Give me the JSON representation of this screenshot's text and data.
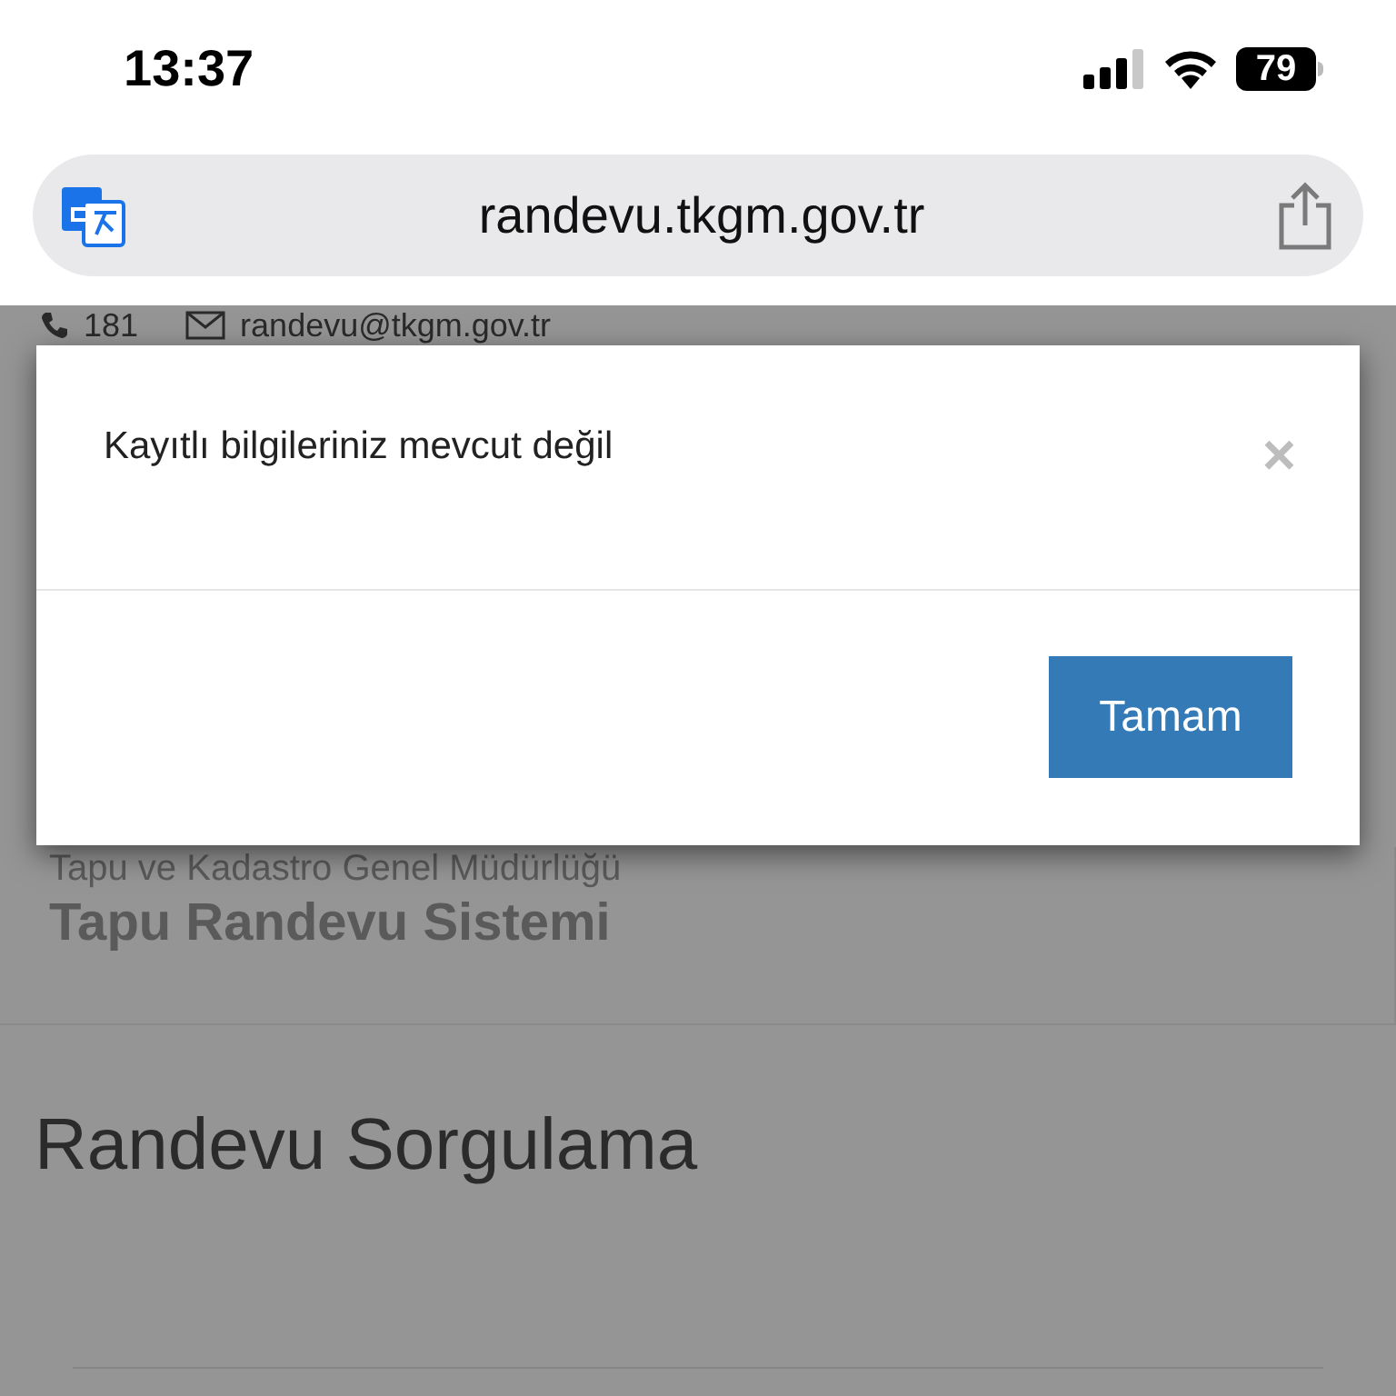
{
  "status_bar": {
    "time": "13:37",
    "battery": "79"
  },
  "address_bar": {
    "url": "randevu.tkgm.gov.tr"
  },
  "page": {
    "phone": "181",
    "email": "randevu@tkgm.gov.tr",
    "org": "Tapu ve Kadastro Genel Müdürlüğü",
    "system": "Tapu Randevu Sistemi",
    "heading": "Randevu Sorgulama"
  },
  "dialog": {
    "message": "Kayıtlı bilgileriniz mevcut değil",
    "close": "×",
    "button": "Tamam"
  }
}
